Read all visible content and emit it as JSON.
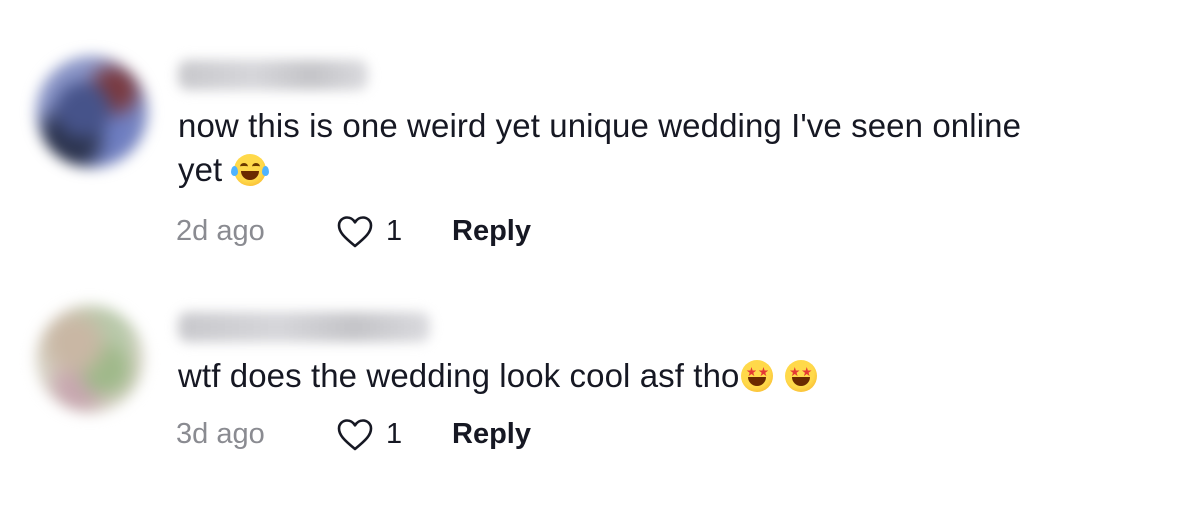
{
  "comments": [
    {
      "text": "now this is one weird yet unique wedding I've seen online yet",
      "emoji": "😂",
      "emoji_icon": "face-with-tears-of-joy-icon",
      "timestamp": "2d ago",
      "likes": "1",
      "reply_label": "Reply"
    },
    {
      "text": "wtf does the wedding look cool asf tho",
      "emoji": "🤩",
      "emoji_icon": "star-struck-icon",
      "timestamp": "3d ago",
      "likes": "1",
      "reply_label": "Reply"
    }
  ],
  "colors": {
    "text_primary": "#161823",
    "text_secondary": "#8a8b91",
    "background": "#ffffff"
  }
}
